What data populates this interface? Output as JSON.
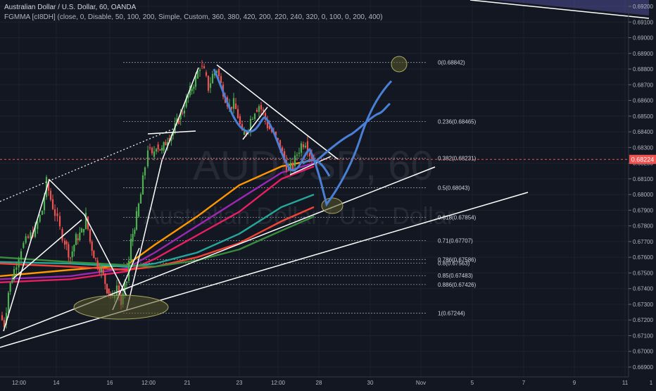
{
  "header": {
    "title": "Australian Dollar / U.S. Dollar, 60, OANDA",
    "indicator": "FGMMA [cI8DH] (close, 0, Disable, 50, 100, 200, Simple, Custom, 360, 380, 420, 200, 220, 240, 320, 0, 100, 0, 200, 400)"
  },
  "watermark": {
    "symbol": "AUDUSD, 60",
    "name": "Australian Dollar / U.S. Dollar"
  },
  "colors": {
    "background": "#131722",
    "grid": "#1e222d",
    "up_candle": "#4caf50",
    "down_candle": "#ef5350",
    "drawing": "#ffffff",
    "projection": "#4a7fd6",
    "current_price": "#ef5350",
    "ellipse_fill": "#5a5a2a",
    "ellipse_stroke": "#a8a860"
  },
  "chart_data": {
    "type": "candlestick",
    "symbol": "AUDUSD",
    "timeframe": "60",
    "ylim": [
      0.669,
      0.6922
    ],
    "y_ticks": [
      "0.69200",
      "0.69100",
      "0.69000",
      "0.68900",
      "0.68800",
      "0.68700",
      "0.68600",
      "0.68500",
      "0.68400",
      "0.68300",
      "0.68200",
      "0.68100",
      "0.68000",
      "0.67900",
      "0.67800",
      "0.67700",
      "0.67600",
      "0.67500",
      "0.67400",
      "0.67300",
      "0.67200",
      "0.67100",
      "0.67000",
      "0.66900"
    ],
    "x_ticks": [
      "12:00",
      "14",
      "16",
      "12:00",
      "21",
      "23",
      "12:00",
      "28",
      "30",
      "Nov",
      "5",
      "7",
      "9",
      "11",
      "1"
    ],
    "current_price": {
      "value": 0.68224,
      "label": "0.68224"
    },
    "price_path": [
      [
        0,
        0.6723
      ],
      [
        6,
        0.6717
      ],
      [
        12,
        0.6738
      ],
      [
        20,
        0.6752
      ],
      [
        30,
        0.6766
      ],
      [
        40,
        0.6772
      ],
      [
        50,
        0.6778
      ],
      [
        60,
        0.679
      ],
      [
        66,
        0.6808
      ],
      [
        72,
        0.6797
      ],
      [
        78,
        0.6788
      ],
      [
        85,
        0.6778
      ],
      [
        92,
        0.677
      ],
      [
        100,
        0.676
      ],
      [
        108,
        0.6772
      ],
      [
        116,
        0.6776
      ],
      [
        122,
        0.6786
      ],
      [
        128,
        0.677
      ],
      [
        136,
        0.6758
      ],
      [
        144,
        0.6752
      ],
      [
        152,
        0.674
      ],
      [
        160,
        0.6734
      ],
      [
        166,
        0.6742
      ],
      [
        172,
        0.673
      ],
      [
        180,
        0.6745
      ],
      [
        186,
        0.677
      ],
      [
        194,
        0.6786
      ],
      [
        200,
        0.68
      ],
      [
        206,
        0.6818
      ],
      [
        210,
        0.683
      ],
      [
        216,
        0.6824
      ],
      [
        222,
        0.6832
      ],
      [
        230,
        0.6828
      ],
      [
        238,
        0.6836
      ],
      [
        246,
        0.684
      ],
      [
        254,
        0.6848
      ],
      [
        262,
        0.6856
      ],
      [
        270,
        0.6866
      ],
      [
        278,
        0.6874
      ],
      [
        284,
        0.6882
      ],
      [
        290,
        0.6878
      ],
      [
        296,
        0.6868
      ],
      [
        302,
        0.6876
      ],
      [
        308,
        0.688
      ],
      [
        314,
        0.687
      ],
      [
        320,
        0.6862
      ],
      [
        326,
        0.6856
      ],
      [
        332,
        0.6858
      ],
      [
        338,
        0.685
      ],
      [
        344,
        0.6838
      ],
      [
        350,
        0.684
      ],
      [
        356,
        0.6848
      ],
      [
        362,
        0.6854
      ],
      [
        368,
        0.6857
      ],
      [
        374,
        0.6852
      ],
      [
        380,
        0.6844
      ],
      [
        386,
        0.684
      ],
      [
        392,
        0.6836
      ],
      [
        398,
        0.683
      ],
      [
        404,
        0.6822
      ],
      [
        410,
        0.6816
      ],
      [
        416,
        0.6818
      ],
      [
        422,
        0.6826
      ],
      [
        428,
        0.6832
      ],
      [
        434,
        0.6834
      ],
      [
        440,
        0.6826
      ],
      [
        446,
        0.6822
      ],
      [
        450,
        0.6824
      ]
    ],
    "moving_averages": [
      {
        "color": "#ff9800",
        "values": [
          [
            0,
            0.6748
          ],
          [
            100,
            0.6752
          ],
          [
            180,
            0.6755
          ],
          [
            220,
            0.6768
          ],
          [
            280,
            0.6786
          ],
          [
            340,
            0.6806
          ],
          [
            400,
            0.6818
          ],
          [
            446,
            0.6822
          ]
        ]
      },
      {
        "color": "#9c27b0",
        "values": [
          [
            0,
            0.6746
          ],
          [
            100,
            0.6748
          ],
          [
            180,
            0.6753
          ],
          [
            220,
            0.6763
          ],
          [
            280,
            0.678
          ],
          [
            340,
            0.6797
          ],
          [
            400,
            0.6814
          ],
          [
            446,
            0.682
          ]
        ]
      },
      {
        "color": "#e91e63",
        "values": [
          [
            0,
            0.6744
          ],
          [
            100,
            0.6746
          ],
          [
            180,
            0.6751
          ],
          [
            220,
            0.6759
          ],
          [
            280,
            0.6774
          ],
          [
            340,
            0.6789
          ],
          [
            400,
            0.681
          ],
          [
            446,
            0.6818
          ]
        ]
      },
      {
        "color": "#26a69a",
        "values": [
          [
            0,
            0.6757
          ],
          [
            100,
            0.6756
          ],
          [
            180,
            0.6754
          ],
          [
            220,
            0.6756
          ],
          [
            280,
            0.6763
          ],
          [
            340,
            0.6775
          ],
          [
            400,
            0.6792
          ],
          [
            446,
            0.68
          ]
        ]
      },
      {
        "color": "#f44336",
        "values": [
          [
            0,
            0.6756
          ],
          [
            100,
            0.6754
          ],
          [
            180,
            0.6752
          ],
          [
            220,
            0.6754
          ],
          [
            280,
            0.676
          ],
          [
            340,
            0.6769
          ],
          [
            400,
            0.6783
          ],
          [
            446,
            0.6792
          ]
        ]
      },
      {
        "color": "#388e3c",
        "values": [
          [
            0,
            0.676
          ],
          [
            100,
            0.6757
          ],
          [
            180,
            0.6755
          ],
          [
            220,
            0.6754
          ],
          [
            280,
            0.6758
          ],
          [
            340,
            0.6765
          ],
          [
            400,
            0.6777
          ],
          [
            446,
            0.6786
          ]
        ]
      }
    ],
    "fibonacci": [
      {
        "label": "0(0.68842)",
        "value": 0.68842
      },
      {
        "label": "0.236(0.68465)",
        "value": 0.68465
      },
      {
        "label": "0.382(0.68231)",
        "value": 0.68231
      },
      {
        "label": "0.5(0.68043)",
        "value": 0.68043
      },
      {
        "label": "0.618(0.67854)",
        "value": 0.67854
      },
      {
        "label": "0.71(0.67707)",
        "value": 0.67707
      },
      {
        "label": "0.786(0.67586)",
        "value": 0.67586
      },
      {
        "label": "0.8(0.67563)",
        "value": 0.67563
      },
      {
        "label": "0.85(0.67483)",
        "value": 0.67483
      },
      {
        "label": "0.886(0.67426)",
        "value": 0.67426
      },
      {
        "label": "1(0.67244)",
        "value": 0.67244
      }
    ],
    "grid": true
  }
}
